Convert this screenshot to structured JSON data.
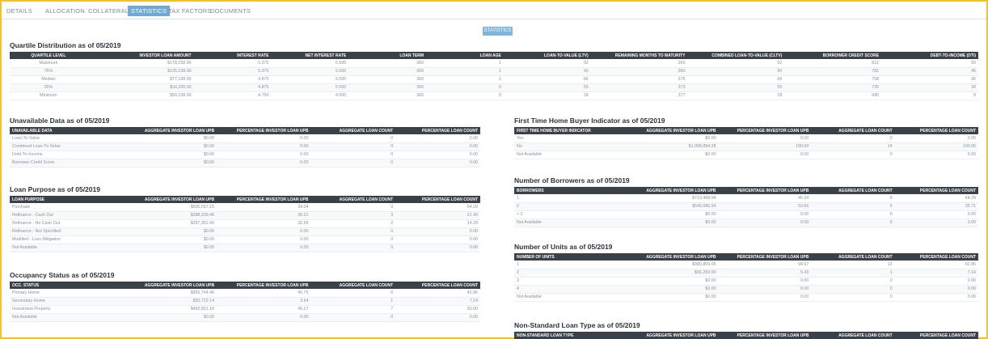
{
  "tabs": [
    "DETAILS",
    "ALLOCATION",
    "COLLATERAL",
    "STATISTICS",
    "TAX FACTORS",
    "DOCUMENTS"
  ],
  "active_tab": "STATISTICS",
  "statistics_button": "STATISTICS",
  "quartile": {
    "title": "Quartile Distribution as of 05/2019",
    "columns": [
      "QUARTILE LEVEL",
      "INVESTOR LOAN AMOUNT",
      "INTEREST RATE",
      "NET INTEREST RATE",
      "LOAN TERM",
      "LOAN AGE",
      "LOAN-TO-VALUE (LTV)",
      "REMAINING MONTHS TO MATURITY",
      "COMBINED LOAN-TO-VALUE (CLTV)",
      "BORROWER CREDIT SCORE",
      "DEBT-TO-INCOME (DTI)"
    ],
    "rows": [
      [
        "Maximum",
        "$178,258.00",
        "5.375",
        "5.500",
        "360",
        "1",
        "92",
        "360",
        "92",
        "812",
        "50"
      ],
      [
        "75%",
        "$135,238.00",
        "5.375",
        "5.500",
        "360",
        "1",
        "90",
        "360",
        "90",
        "781",
        "45"
      ],
      [
        "Median",
        "$77,198.00",
        "4.875",
        "5.500",
        "360",
        "1",
        "66",
        "375",
        "66",
        "758",
        "36"
      ],
      [
        "25%",
        "$34,200.00",
        "4.875",
        "5.500",
        "360",
        "0",
        "55",
        "373",
        "55",
        "735",
        "30"
      ],
      [
        "Minimum",
        "$50,238.00",
        "4.750",
        "4.500",
        "360",
        "0",
        "18",
        "377",
        "18",
        "680",
        "9"
      ]
    ]
  },
  "unavailable": {
    "title": "Unavailable Data as of 05/2019",
    "columns": [
      "UNAVAILABLE DATA",
      "AGGREGATE INVESTOR LOAN UPB",
      "PERCENTAGE INVESTOR LOAN UPB",
      "AGGREGATE LOAN COUNT",
      "PERCENTAGE LOAN COUNT"
    ],
    "rows": [
      [
        "Loan-To-Value",
        "$0.00",
        "0.00",
        "0",
        "0.00"
      ],
      [
        "Combined Loan-To-Value",
        "$0.00",
        "0.00",
        "0",
        "0.00"
      ],
      [
        "Debt-To-Income",
        "$0.00",
        "0.00",
        "0",
        "0.00"
      ],
      [
        "Borrower Credit Score",
        "$0.00",
        "0.00",
        "0",
        "0.00"
      ]
    ]
  },
  "loan_purpose": {
    "title": "Loan Purpose as of 05/2019",
    "columns": [
      "LOAN PURPOSE",
      "AGGREGATE INVESTOR LOAN UPB",
      "PERCENTAGE INVESTOR LOAN UPB",
      "AGGREGATE LOAN COUNT",
      "PERCENTAGE LOAN COUNT"
    ],
    "rows": [
      [
        "Purchase",
        "$505,557.15",
        "39.04",
        "9",
        "64.29"
      ],
      [
        "Refinance - Cash Out",
        "$288,209.46",
        "28.21",
        "3",
        "21.43"
      ],
      [
        "Refinance - No Cash Out",
        "$287,952.00",
        "32.55",
        "2",
        "14.29"
      ],
      [
        "Refinance - Not Specified",
        "$0.00",
        "0.00",
        "0",
        "0.00"
      ],
      [
        "Modified - Loss Mitigation",
        "$0.00",
        "0.00",
        "0",
        "0.00"
      ],
      [
        "Not Available",
        "$0.00",
        "0.00",
        "0",
        "0.00"
      ]
    ]
  },
  "occupancy": {
    "title": "Occupancy Status as of 05/2019",
    "columns": [
      "OCC. STATUS",
      "AGGREGATE INVESTOR LOAN UPB",
      "PERCENTAGE INVESTOR LOAN UPB",
      "AGGREGATE LOAN COUNT",
      "PERCENTAGE LOAN COUNT"
    ],
    "rows": [
      [
        "Primary Home",
        "$955,744.46",
        "45.75",
        "6",
        "42.86"
      ],
      [
        "Secondary Home",
        "$50,722.14",
        "3.94",
        "1",
        "7.14"
      ],
      [
        "Investment Property",
        "$450,801.18",
        "45.17",
        "7",
        "50.00"
      ],
      [
        "Not Available",
        "$0.00",
        "0.00",
        "0",
        "0.00"
      ]
    ]
  },
  "first_time": {
    "title": "First Time Home Buyer Indicator as of 05/2019",
    "columns": [
      "FIRST TIME HOME BUYER INDICATOR",
      "AGGREGATE INVESTOR LOAN UPB",
      "PERCENTAGE INVESTOR LOAN UPB",
      "AGGREGATE LOAN COUNT",
      "PERCENTAGE LOAN COUNT"
    ],
    "rows": [
      [
        "Yes",
        "$0.00",
        "0.00",
        "0",
        "0.00"
      ],
      [
        "No",
        "$1,058,894.28",
        "100.00",
        "14",
        "100.00"
      ],
      [
        "Not Available",
        "$0.00",
        "0.00",
        "0",
        "0.00"
      ]
    ]
  },
  "borrowers": {
    "title": "Number of Borrowers as of 05/2019",
    "columns": [
      "BORROWERS",
      "AGGREGATE INVESTOR LOAN UPB",
      "PERCENTAGE INVESTOR LOAN UPB",
      "AGGREGATE LOAN COUNT",
      "PERCENTAGE LOAN COUNT"
    ],
    "rows": [
      [
        "1",
        "$713,488.54",
        "46.34",
        "9",
        "64.29"
      ],
      [
        "2",
        "$545,086.54",
        "53.66",
        "5",
        "35.71"
      ],
      [
        "> 2",
        "$0.00",
        "0.00",
        "0",
        "0.00"
      ],
      [
        "Not Available",
        "$0.00",
        "0.00",
        "0",
        "0.00"
      ]
    ]
  },
  "units": {
    "title": "Number of Units as of 05/2019",
    "columns": [
      "NUMBER OF UNITS",
      "AGGREGATE INVESTOR LOAN UPB",
      "PERCENTAGE INVESTOR LOAN UPB",
      "AGGREGATE LOAN COUNT",
      "PERCENTAGE LOAN COUNT"
    ],
    "rows": [
      [
        "1",
        "$980,805.06",
        "94.57",
        "13",
        "92.86"
      ],
      [
        "2",
        "$56,283.00",
        "5.43",
        "1",
        "7.14"
      ],
      [
        "3",
        "$0.00",
        "0.00",
        "0",
        "0.00"
      ],
      [
        "4",
        "$0.00",
        "0.00",
        "0",
        "0.00"
      ],
      [
        "Not Available",
        "$0.00",
        "0.00",
        "0",
        "0.00"
      ]
    ]
  },
  "non_standard": {
    "title": "Non-Standard Loan Type as of 05/2019",
    "columns": [
      "NON-STANDARD LOAN TYPE",
      "AGGREGATE INVESTOR LOAN UPB",
      "PERCENTAGE INVESTOR LOAN UPB",
      "AGGREGATE LOAN COUNT",
      "PERCENTAGE LOAN COUNT"
    ]
  }
}
